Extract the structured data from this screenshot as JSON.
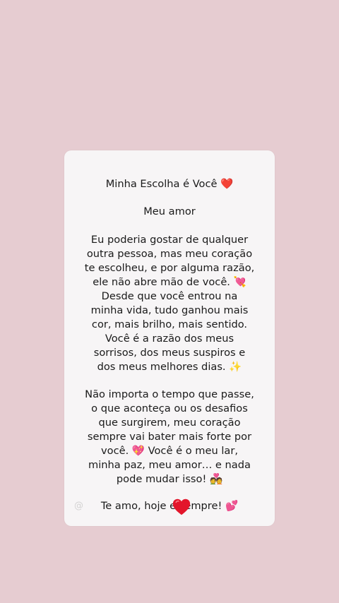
{
  "note": {
    "title": "Minha Escolha é Você ❤️",
    "greeting": "Meu amor",
    "paragraph1": "Eu poderia gostar de qualquer\noutra pessoa, mas meu coração\nte escolheu, e por alguma razão,\nele não abre mão de você. 💘\nDesde que você entrou na\nminha vida, tudo ganhou mais\ncor, mais brilho, mais sentido.\nVocê é a razão dos meus\nsorrisos, dos meus suspiros e\ndos meus melhores dias. ✨",
    "paragraph2": "Não importa o tempo que passe,\no que aconteça ou os desafios\nque surgirem, meu coração\nsempre vai bater mais forte por\nvocê. 💖 Você é o meu lar,\nminha paz, meu amor… e nada\npode mudar isso! 💑",
    "closing": "Te amo, hoje e sempre! 💕"
  },
  "watermark": {
    "handle": "@"
  },
  "colors": {
    "background": "#e6ccd1",
    "card": "#f7f5f6",
    "text": "#1a1a1a",
    "heart": "#e3162b"
  },
  "sticker": {
    "icon": "red-heart-icon"
  }
}
